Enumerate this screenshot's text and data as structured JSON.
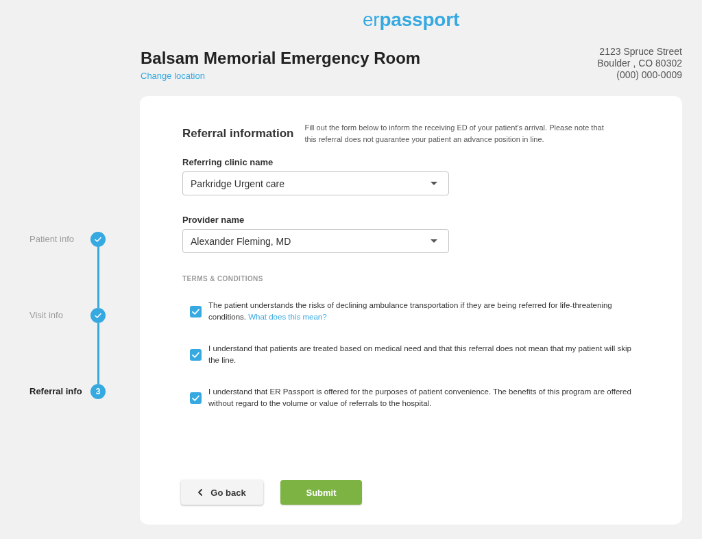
{
  "logo": "er**passport**",
  "location": {
    "name": "Balsam Memorial Emergency Room",
    "change_link": "Change location",
    "address": {
      "street": "2123 Spruce Street",
      "city": "Boulder , CO 80302",
      "phone": "(000) 000-0009"
    }
  },
  "stepper": {
    "steps": [
      {
        "label": "Patient info",
        "completed": true,
        "selected": false
      },
      {
        "label": "Visit info",
        "completed": true,
        "selected": false
      },
      {
        "label": "Referral info",
        "completed": false,
        "selected": true,
        "number": "3"
      }
    ]
  },
  "form": {
    "title": "Referral information",
    "description": "Fill out the form below to inform the receiving ED of your patient's arrival. Please note that this referral does not guarantee your patient an advance position in line.",
    "fields": [
      {
        "label": "Referring clinic name",
        "value": "Parkridge Urgent care"
      },
      {
        "label": "Provider name",
        "value": "Alexander Fleming, MD"
      }
    ],
    "terms": {
      "heading": "TERMS & CONDITIONS",
      "items": [
        {
          "text": "The patient understands the risks of declining ambulance transportation if they are being referred for life-threatening conditions.",
          "link": "What does this mean?",
          "checked": true
        },
        {
          "text": "I understand that patients are treated based on medical need and that this referral does not mean that my patient will skip the line.",
          "checked": true
        },
        {
          "text": "I understand that ER Passport is offered for the purposes of patient convenience. The benefits of this program are offered without regard to the volume or value of referrals to the hospital.",
          "checked": true
        }
      ]
    },
    "buttons": [
      {
        "label": "Go back",
        "kind": "back"
      },
      {
        "label": "Submit",
        "kind": "submit"
      }
    ]
  }
}
